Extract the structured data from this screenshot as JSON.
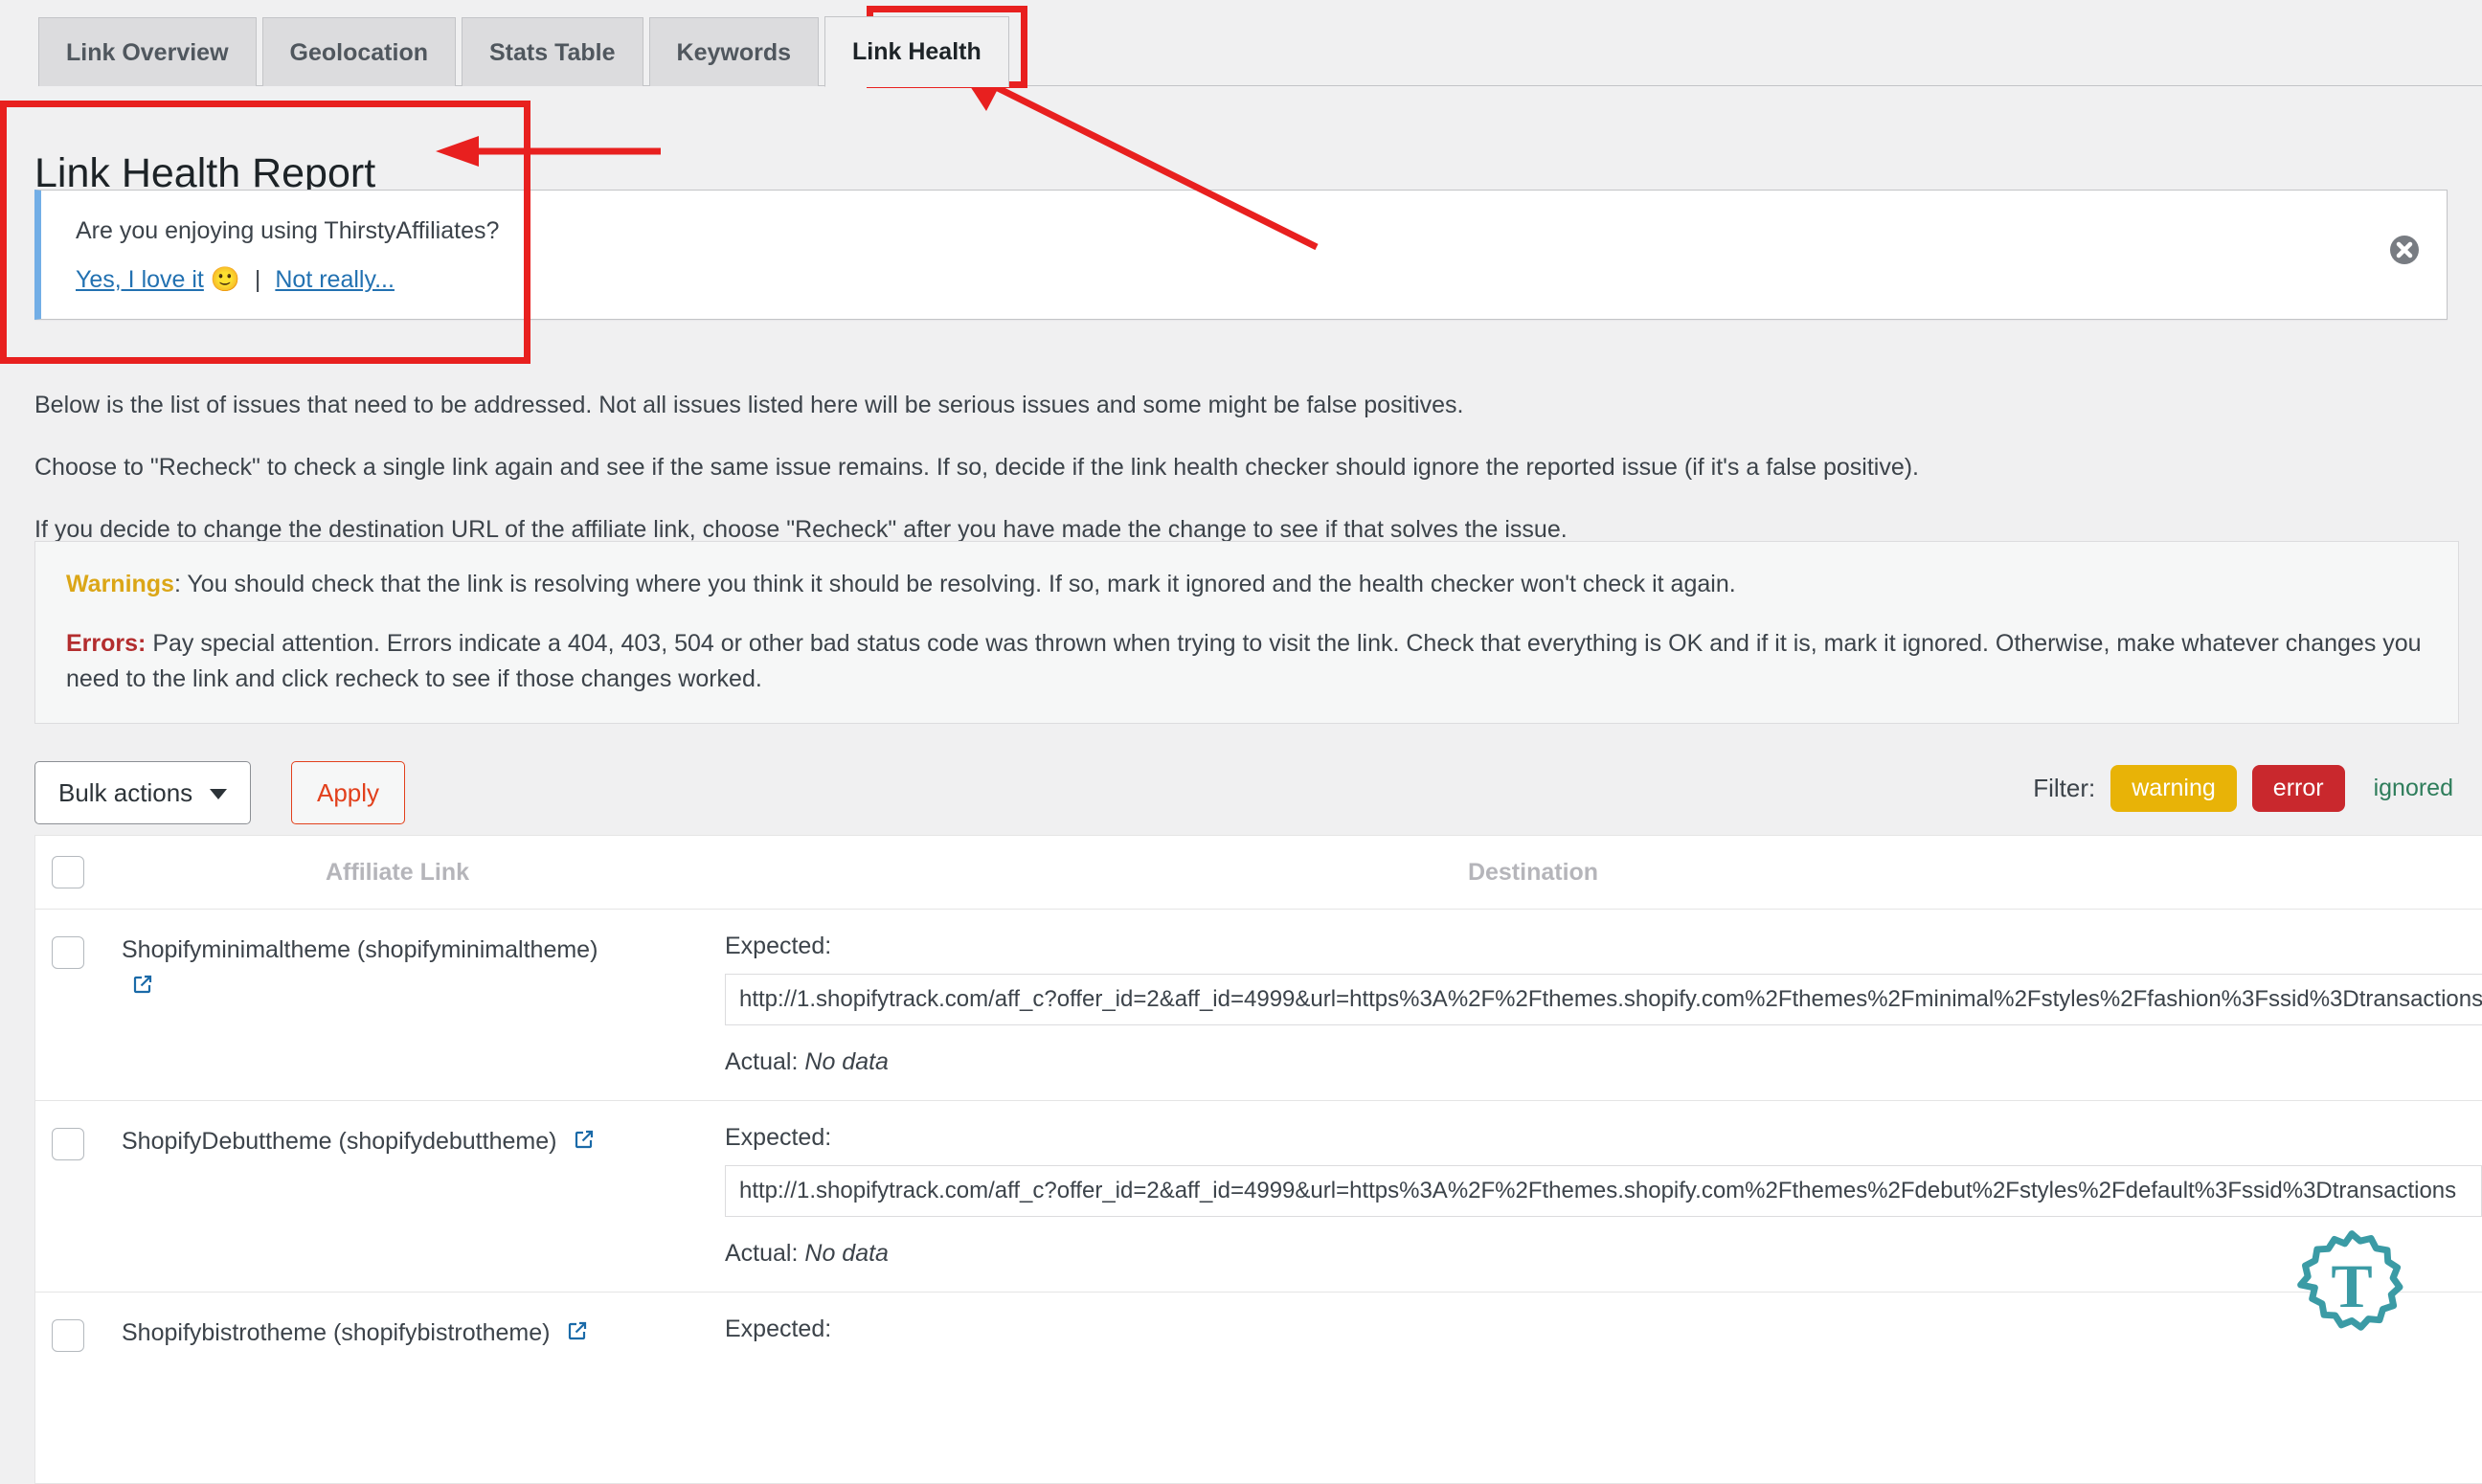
{
  "tabs": [
    {
      "label": "Link Overview",
      "active": false
    },
    {
      "label": "Geolocation",
      "active": false
    },
    {
      "label": "Stats Table",
      "active": false
    },
    {
      "label": "Keywords",
      "active": false
    },
    {
      "label": "Link Health",
      "active": true
    }
  ],
  "page": {
    "title": "Link Health Report"
  },
  "notice": {
    "question": "Are you enjoying using ThirstyAffiliates?",
    "yes_label": "Yes, I love it",
    "emoji": "🙂",
    "separator": "|",
    "no_label": "Not really...",
    "dismiss_icon": "close-circle-icon",
    "accent_color": "#72aee6"
  },
  "intro": {
    "p1": "Below is the list of issues that need to be addressed. Not all issues listed here will be serious issues and some might be false positives.",
    "p2": "Choose to \"Recheck\" to check a single link again and see if the same issue remains. If so, decide if the link health checker should ignore the reported issue (if it's a false positive).",
    "p3": "If you decide to change the destination URL of the affiliate link, choose \"Recheck\" after you have made the change to see if that solves the issue."
  },
  "infobox": {
    "warning_label": "Warnings",
    "warning_color": "#dba617",
    "warning_text": ": You should check that the link is resolving where you think it should be resolving. If so, mark it ignored and the health checker won't check it again.",
    "error_label": "Errors:",
    "error_color": "#b32d2e",
    "error_text": " Pay special attention. Errors indicate a 404, 403, 504 or other bad status code was thrown when trying to visit the link. Check that everything is OK and if it is, mark it ignored. Otherwise, make whatever changes you need to the link and click recheck to see if those changes worked."
  },
  "toolbar": {
    "bulk_actions_label": "Bulk actions",
    "bulk_actions_icon": "chevron-down-icon",
    "apply_label": "Apply",
    "filter_label": "Filter:",
    "filters": [
      {
        "label": "warning",
        "color": "#e8b307",
        "style": "solid"
      },
      {
        "label": "error",
        "color": "#c9282d",
        "style": "solid"
      },
      {
        "label": "ignored",
        "color": "#2e7d5b",
        "style": "text"
      }
    ]
  },
  "table": {
    "headers": {
      "affiliate_link": "Affiliate Link",
      "destination": "Destination"
    },
    "expected_label": "Expected:",
    "actual_label": "Actual:",
    "rows": [
      {
        "name": "Shopifyminimaltheme (shopifyminimaltheme)",
        "external_icon": "external-link-icon",
        "icon_on_new_line": true,
        "expected_url": "http://1.shopifytrack.com/aff_c?offer_id=2&aff_id=4999&url=https%3A%2F%2Fthemes.shopify.com%2Fthemes%2Fminimal%2Fstyles%2Ffashion%3Fssid%3Dtransactions",
        "actual_value": "No data"
      },
      {
        "name": "ShopifyDebuttheme (shopifydebuttheme)",
        "external_icon": "external-link-icon",
        "icon_on_new_line": false,
        "expected_url": "http://1.shopifytrack.com/aff_c?offer_id=2&aff_id=4999&url=https%3A%2F%2Fthemes.shopify.com%2Fthemes%2Fdebut%2Fstyles%2Fdefault%3Fssid%3Dtransactions",
        "actual_value": "No data"
      },
      {
        "name": "Shopifybistrotheme (shopifybistrotheme)",
        "external_icon": "external-link-icon",
        "icon_on_new_line": false,
        "expected_url": "",
        "actual_value": ""
      }
    ]
  },
  "annotations": {
    "color": "#e8201f",
    "tab_highlight": "Link Health",
    "title_highlight": "Link Health Report"
  },
  "brand": {
    "badge_letter": "T",
    "badge_color": "#3b9ba5",
    "badge_icon": "thirsty-affiliates-gear-icon"
  }
}
